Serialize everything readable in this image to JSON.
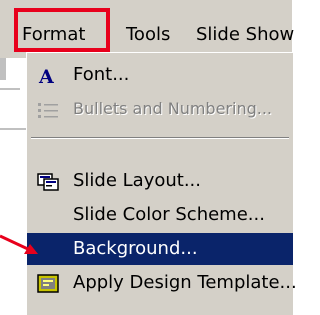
{
  "menubar": {
    "items": [
      {
        "label": "Format",
        "mnemonic": "o"
      },
      {
        "label": "Tools",
        "mnemonic": "T"
      },
      {
        "label": "Slide Show",
        "mnemonic": "d"
      }
    ]
  },
  "dropdown": {
    "items": [
      {
        "label": "Font...",
        "icon": "font-icon",
        "enabled": true
      },
      {
        "label": "Bullets and Numbering...",
        "icon": "bullets-icon",
        "enabled": false
      },
      {
        "label": "Slide Layout...",
        "icon": "slide-layout-icon",
        "enabled": true
      },
      {
        "label": "Slide Color Scheme...",
        "icon": "",
        "enabled": true
      },
      {
        "label": "Background...",
        "icon": "",
        "enabled": true,
        "selected": true
      },
      {
        "label": "Apply Design Template...",
        "icon": "design-template-icon",
        "enabled": true
      }
    ]
  },
  "colors": {
    "menu_face": "#d4d0c8",
    "selection": "#0a246a",
    "annotation_red": "#e8001c"
  }
}
